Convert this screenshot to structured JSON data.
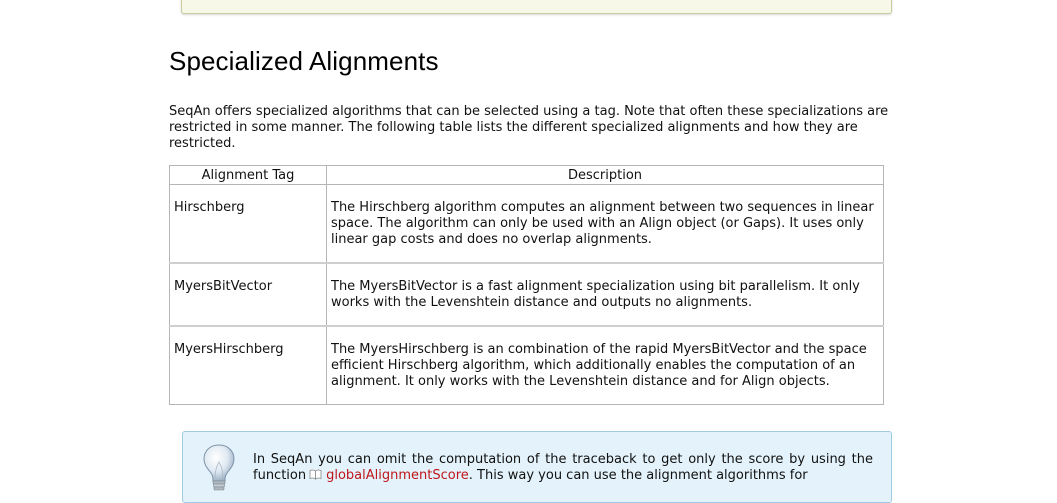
{
  "section": {
    "title": "Specialized Alignments",
    "intro": "SeqAn offers specialized algorithms that can be selected using a tag. Note that often these specializations are restricted in some manner. The following table lists the different specialized alignments and how they are restricted."
  },
  "table": {
    "headers": [
      "Alignment Tag",
      "Description"
    ],
    "rows": [
      {
        "tag": "Hirschberg",
        "description": "The Hirschberg algorithm computes an alignment between two sequences in linear space. The algorithm can only be used with an Align object (or Gaps). It uses only linear gap costs and does no overlap alignments."
      },
      {
        "tag": "MyersBitVector",
        "description": "The MyersBitVector is a fast alignment specialization using bit parallelism. It only works with the Levenshtein distance and outputs no alignments."
      },
      {
        "tag": "MyersHirschberg",
        "description": "The MyersHirschberg is an combination of the rapid MyersBitVector and the space efficient Hirschberg algorithm, which additionally enables the computation of an alignment. It only works with the Levenshtein distance and for Align objects."
      }
    ]
  },
  "tip": {
    "icon": "lightbulb-icon",
    "text_before": "In SeqAn you can omit the computation of the traceback to get only the score by using the function",
    "link_label": "globalAlignmentScore",
    "link_icon": "book-icon",
    "text_after": ". This way you can use the alignment algorithms for",
    "link_color": "#c0151b",
    "background_color": "#e4f3fb"
  }
}
